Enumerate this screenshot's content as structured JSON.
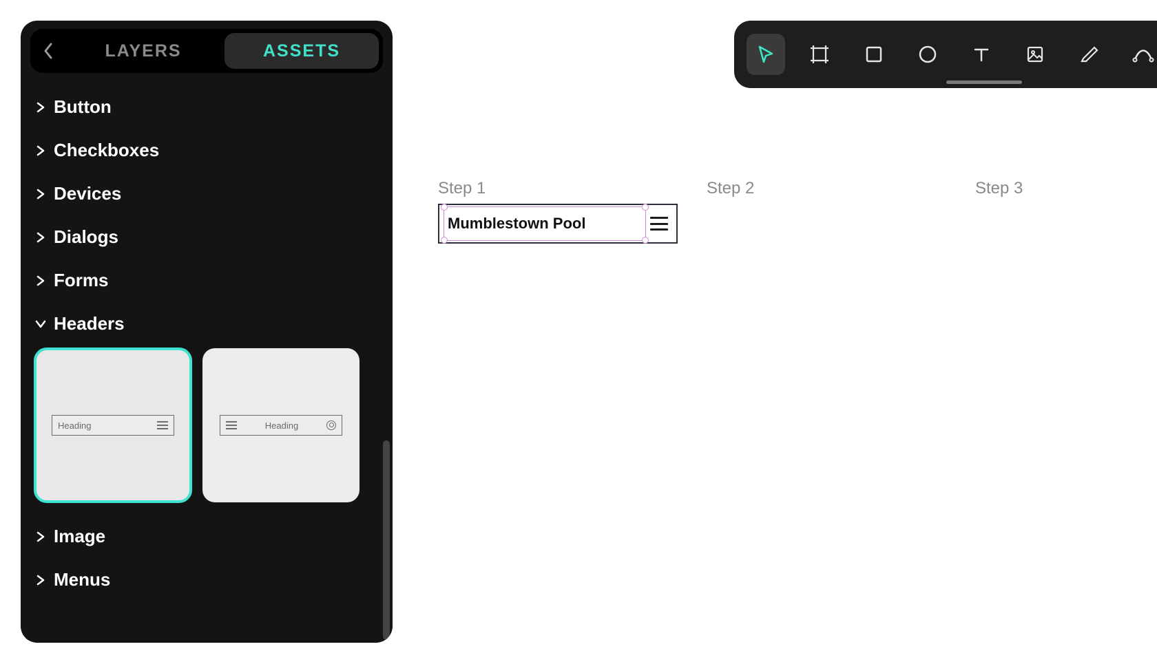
{
  "panel": {
    "tabs": {
      "layers": "LAYERS",
      "assets": "ASSETS"
    },
    "active_tab": "assets",
    "categories": [
      {
        "label": "Button",
        "expanded": false
      },
      {
        "label": "Checkboxes",
        "expanded": false
      },
      {
        "label": "Devices",
        "expanded": false
      },
      {
        "label": "Dialogs",
        "expanded": false
      },
      {
        "label": "Forms",
        "expanded": false
      },
      {
        "label": "Headers",
        "expanded": true
      },
      {
        "label": "Image",
        "expanded": false
      },
      {
        "label": "Menus",
        "expanded": false
      }
    ],
    "thumb_label": "Heading"
  },
  "toolbar": {
    "tools": [
      "select",
      "frame",
      "rectangle",
      "ellipse",
      "text",
      "image",
      "pen",
      "curve"
    ],
    "active": "select"
  },
  "canvas": {
    "steps": [
      "Step 1",
      "Step 2",
      "Step 3"
    ],
    "frame_heading": "Mumblestown Pool"
  },
  "colors": {
    "accent": "#3de6c6",
    "selection": "#d18bd6"
  }
}
